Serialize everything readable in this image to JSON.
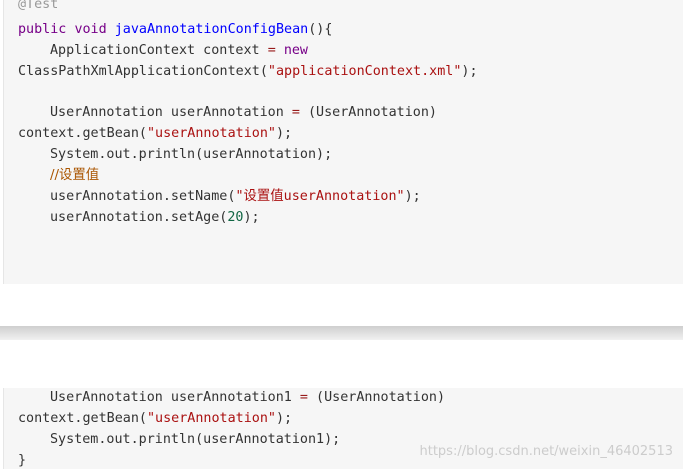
{
  "code_top": {
    "line1": "@Test",
    "line2": {
      "kw_public": "public",
      "kw_void": "void",
      "method": "javaAnnotationConfigBean",
      "rest": "(){"
    },
    "line3": {
      "type": "ApplicationContext",
      "var": " context ",
      "eq": "=",
      "kw_new": "new"
    },
    "line4": {
      "cls": "ClassPathXmlApplicationContext(",
      "str": "\"applicationContext.xml\"",
      "end": ");"
    },
    "line6": {
      "pre": "UserAnnotation userAnnotation ",
      "eq": "=",
      "post": " (UserAnnotation)"
    },
    "line7": {
      "pre": "context.getBean(",
      "str": "\"userAnnotation\"",
      "end": ");"
    },
    "line8": "System.out.println(userAnnotation);",
    "line9": "//设置值",
    "line10": {
      "pre": "userAnnotation.setName(",
      "str": "\"设置值userAnnotation\"",
      "end": ");"
    },
    "line11": {
      "pre": "userAnnotation.setAge(",
      "num": "20",
      "end": ");"
    }
  },
  "code_bottom": {
    "line1": {
      "pre": "UserAnnotation userAnnotation1 ",
      "eq": "=",
      "post": " (UserAnnotation)"
    },
    "line2": {
      "pre": "context.getBean(",
      "str": "\"userAnnotation\"",
      "end": ");"
    },
    "line3": "System.out.println(userAnnotation1);",
    "line4": "}"
  },
  "watermark": "https://blog.csdn.net/weixin_46402513"
}
